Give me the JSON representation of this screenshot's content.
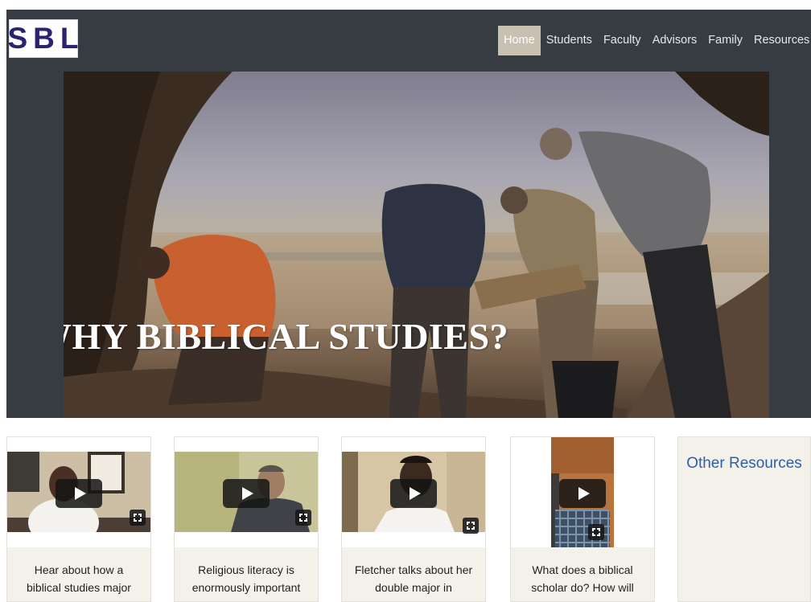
{
  "brand": {
    "logo_text_left": "S",
    "logo_text_mid": "B",
    "logo_text_right": "L"
  },
  "nav": {
    "items": [
      {
        "label": "Home",
        "active": true
      },
      {
        "label": "Students",
        "active": false
      },
      {
        "label": "Faculty",
        "active": false
      },
      {
        "label": "Advisors",
        "active": false
      },
      {
        "label": "Family",
        "active": false
      },
      {
        "label": "Resources",
        "active": false
      }
    ]
  },
  "hero": {
    "title": "WHY BIBLICAL STUDIES?"
  },
  "videos": [
    {
      "caption": "Hear about how a biblical studies major enabled a"
    },
    {
      "caption": "Religious literacy is enormously important regardless"
    },
    {
      "caption": "Fletcher talks about her double major in Women's Gender"
    },
    {
      "caption": "What does a biblical scholar do? How will this field to their"
    }
  ],
  "other_resources": {
    "label": "Other Resources"
  },
  "colors": {
    "header_bg": "#363c42",
    "nav_active_bg": "#c8c1b1",
    "card_bg": "#f3f1ea",
    "link_blue": "#2e5fa5",
    "logo_ink": "#2a2470"
  }
}
